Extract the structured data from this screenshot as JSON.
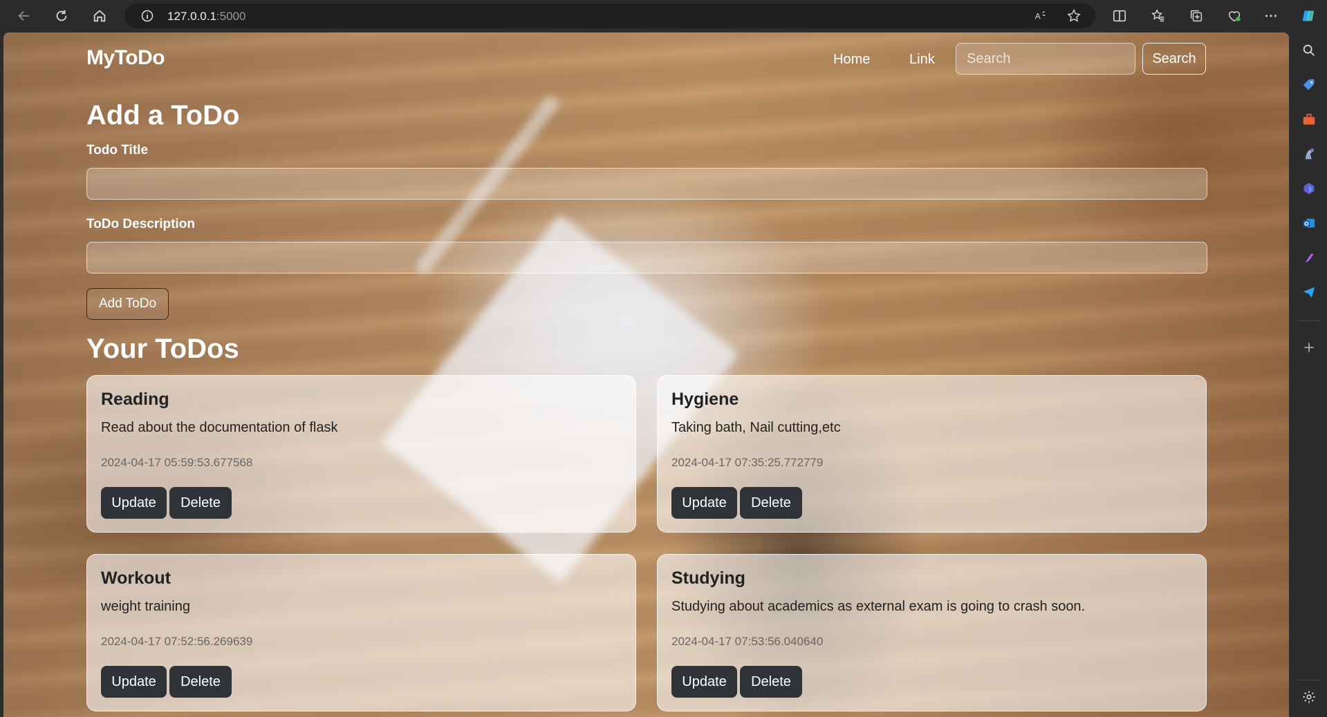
{
  "browser": {
    "address_host": "127.0.0.1",
    "address_port": ":5000"
  },
  "nav": {
    "brand": "MyToDo",
    "links": [
      "Home",
      "Link"
    ],
    "search_placeholder": "Search",
    "search_button": "Search"
  },
  "form": {
    "heading": "Add a ToDo",
    "title_label": "Todo Title",
    "desc_label": "ToDo Description",
    "submit_label": "Add ToDo"
  },
  "todos": {
    "heading": "Your ToDos",
    "update_label": "Update",
    "delete_label": "Delete",
    "items": [
      {
        "title": "Reading",
        "desc": "Read about the documentation of flask",
        "date": "2024-04-17 05:59:53.677568"
      },
      {
        "title": "Hygiene",
        "desc": "Taking bath, Nail cutting,etc",
        "date": "2024-04-17 07:35:25.772779"
      },
      {
        "title": "Workout",
        "desc": "weight training",
        "date": "2024-04-17 07:52:56.269639"
      },
      {
        "title": "Studying",
        "desc": "Studying about academics as external exam is going to crash soon.",
        "date": "2024-04-17 07:53:56.040640"
      }
    ]
  },
  "colors": {
    "button_dark": "#2f3338",
    "chrome_bg": "#2b2b2b"
  }
}
